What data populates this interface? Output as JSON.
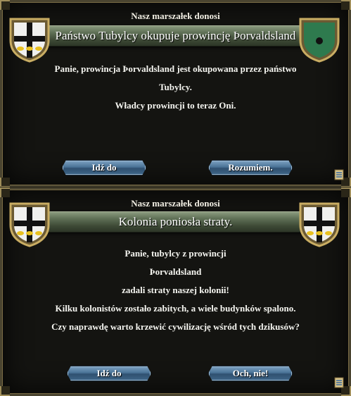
{
  "panels": [
    {
      "header": "Nasz marszałek donosi",
      "title": "Państwo Tubylcy okupuje prowincję Þorvaldsland",
      "body": [
        "Panie, prowincja Þorvaldsland jest okupowana przez państwo",
        "Tubylcy.",
        "Władcy prowincji to teraz Oni."
      ],
      "buttons": [
        "Idź do",
        "Rozumiem."
      ],
      "icons": {
        "left": "white-shield-black-cross-icon",
        "right": "green-shield-icon",
        "corner": "scroll-icon"
      }
    },
    {
      "header": "Nasz marszałek donosi",
      "title": "Kolonia poniosła straty.",
      "body": [
        "Panie, tubylcy z prowincji",
        "Þorvaldsland",
        "zadali straty naszej kolonii!",
        "Kilku kolonistów zostało zabitych, a wiele budynków spalono.",
        "Czy naprawdę warto krzewić cywilizację wśród tych dzikusów?"
      ],
      "buttons": [
        "Idź do",
        "Och,  nie!"
      ],
      "icons": {
        "left": "white-shield-black-cross-icon",
        "right": "white-shield-black-cross-icon",
        "corner": "scroll-icon"
      }
    }
  ],
  "colors": {
    "panel_bg": "#141411",
    "frame_gold": "#a08e5a",
    "title_green": "#5d6e54",
    "button_blue": "#4a7397",
    "shield_white": "#f0f0ee",
    "shield_gold": "#e8c020",
    "shield_green": "#2e7a4e"
  }
}
